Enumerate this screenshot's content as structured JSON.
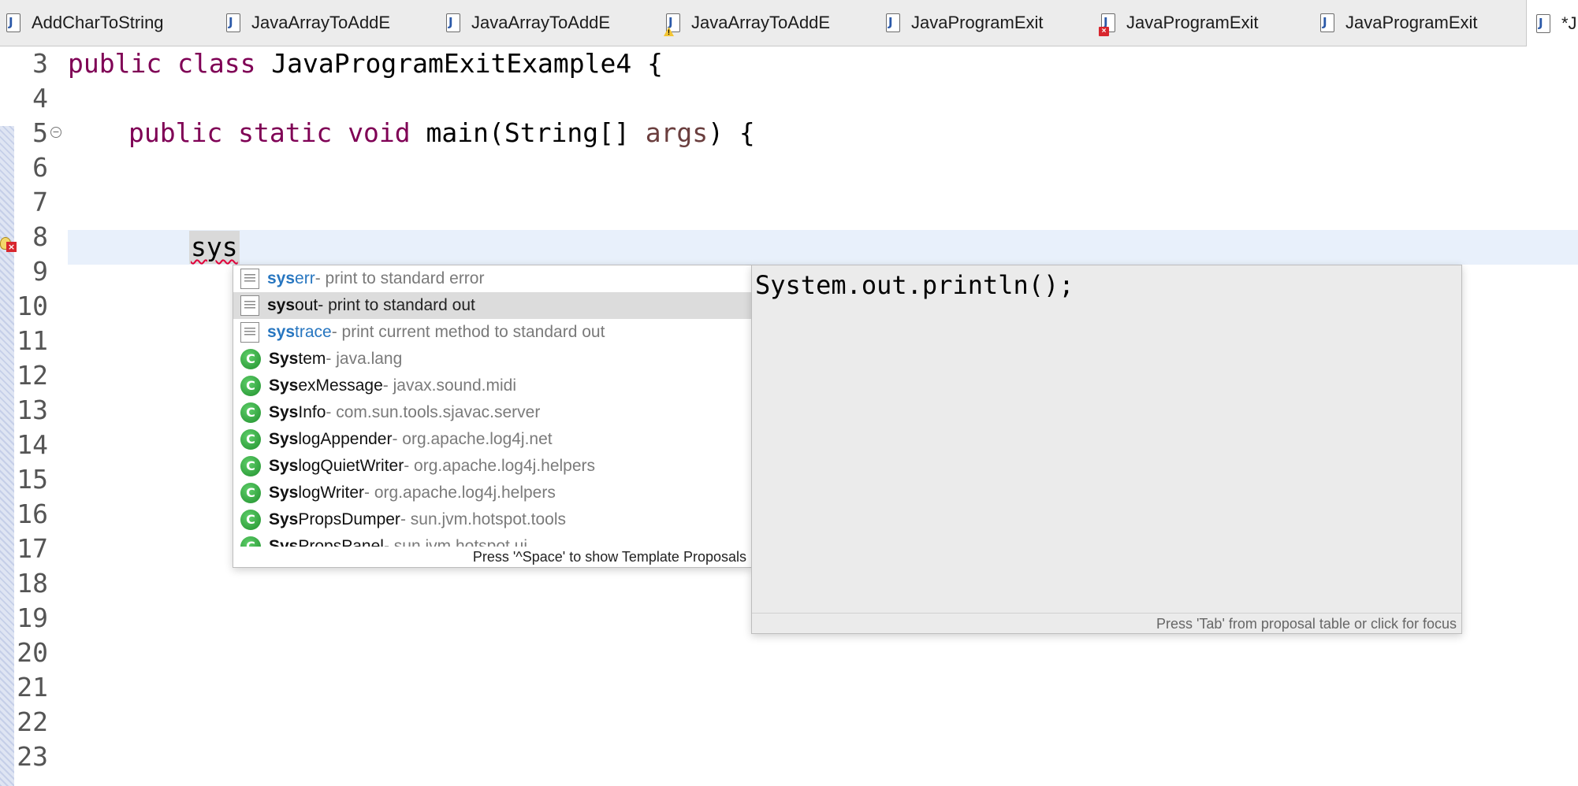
{
  "tabs": [
    {
      "label": "AddCharToString",
      "badge": ""
    },
    {
      "label": "JavaArrayToAddE",
      "badge": ""
    },
    {
      "label": "JavaArrayToAddE",
      "badge": ""
    },
    {
      "label": "JavaArrayToAddE",
      "badge": "warning"
    },
    {
      "label": "JavaProgramExit",
      "badge": ""
    },
    {
      "label": "JavaProgramExit",
      "badge": "error"
    },
    {
      "label": "JavaProgramExit",
      "badge": ""
    },
    {
      "label": "*J",
      "badge": ""
    }
  ],
  "editor": {
    "line_numbers": [
      "3",
      "4",
      "5",
      "6",
      "7",
      "8",
      "9",
      "10",
      "11",
      "12",
      "13",
      "14",
      "15",
      "16",
      "17",
      "18",
      "19",
      "20",
      "21",
      "22",
      "23"
    ],
    "line3": {
      "kw1": "public",
      "kw2": "class",
      "rest": " JavaProgramExitExample4 {"
    },
    "line5": {
      "kw1": "public",
      "kw2": "static",
      "kw3": "void",
      "mid": " main(String[] ",
      "param": "args",
      "end": ") {"
    },
    "typed_text": "sys"
  },
  "proposals": [
    {
      "match": "sys",
      "rest": "err",
      "desc": " - print to standard error",
      "icon": "template-icon",
      "kind": "template"
    },
    {
      "match": "sys",
      "rest": "out",
      "desc": " - print to standard out",
      "icon": "template-icon",
      "kind": "template-selected"
    },
    {
      "match": "sys",
      "rest": "trace",
      "desc": " - print current method to standard out",
      "icon": "template-icon",
      "kind": "template"
    },
    {
      "match": "Sys",
      "rest": "tem",
      "desc": " - java.lang",
      "icon": "class-icon",
      "kind": "class"
    },
    {
      "match": "Sys",
      "rest": "exMessage",
      "desc": " - javax.sound.midi",
      "icon": "class-icon",
      "kind": "class"
    },
    {
      "match": "Sys",
      "rest": "Info",
      "desc": " - com.sun.tools.sjavac.server",
      "icon": "class-icon",
      "kind": "class"
    },
    {
      "match": "Sys",
      "rest": "logAppender",
      "desc": " - org.apache.log4j.net",
      "icon": "class-icon",
      "kind": "class"
    },
    {
      "match": "Sys",
      "rest": "logQuietWriter",
      "desc": " - org.apache.log4j.helpers",
      "icon": "class-icon",
      "kind": "class"
    },
    {
      "match": "Sys",
      "rest": "logWriter",
      "desc": " - org.apache.log4j.helpers",
      "icon": "class-icon",
      "kind": "class"
    },
    {
      "match": "Sys",
      "rest": "PropsDumper",
      "desc": " - sun.jvm.hotspot.tools",
      "icon": "class-icon",
      "kind": "class"
    },
    {
      "match": "Sys",
      "rest": "PropsPanel",
      "desc": " - sun.jvm.hotspot.ui",
      "icon": "class-icon",
      "kind": "class"
    }
  ],
  "proposals_footer": "Press '^Space' to show Template Proposals",
  "details": {
    "preview": "System.out.println();",
    "footer": "Press 'Tab' from proposal table or click for focus"
  },
  "colors": {
    "keyword": "#7f0055",
    "parameter": "#6a3e3e",
    "template_match": "#2776c0",
    "current_line": "#e8f0fb"
  }
}
